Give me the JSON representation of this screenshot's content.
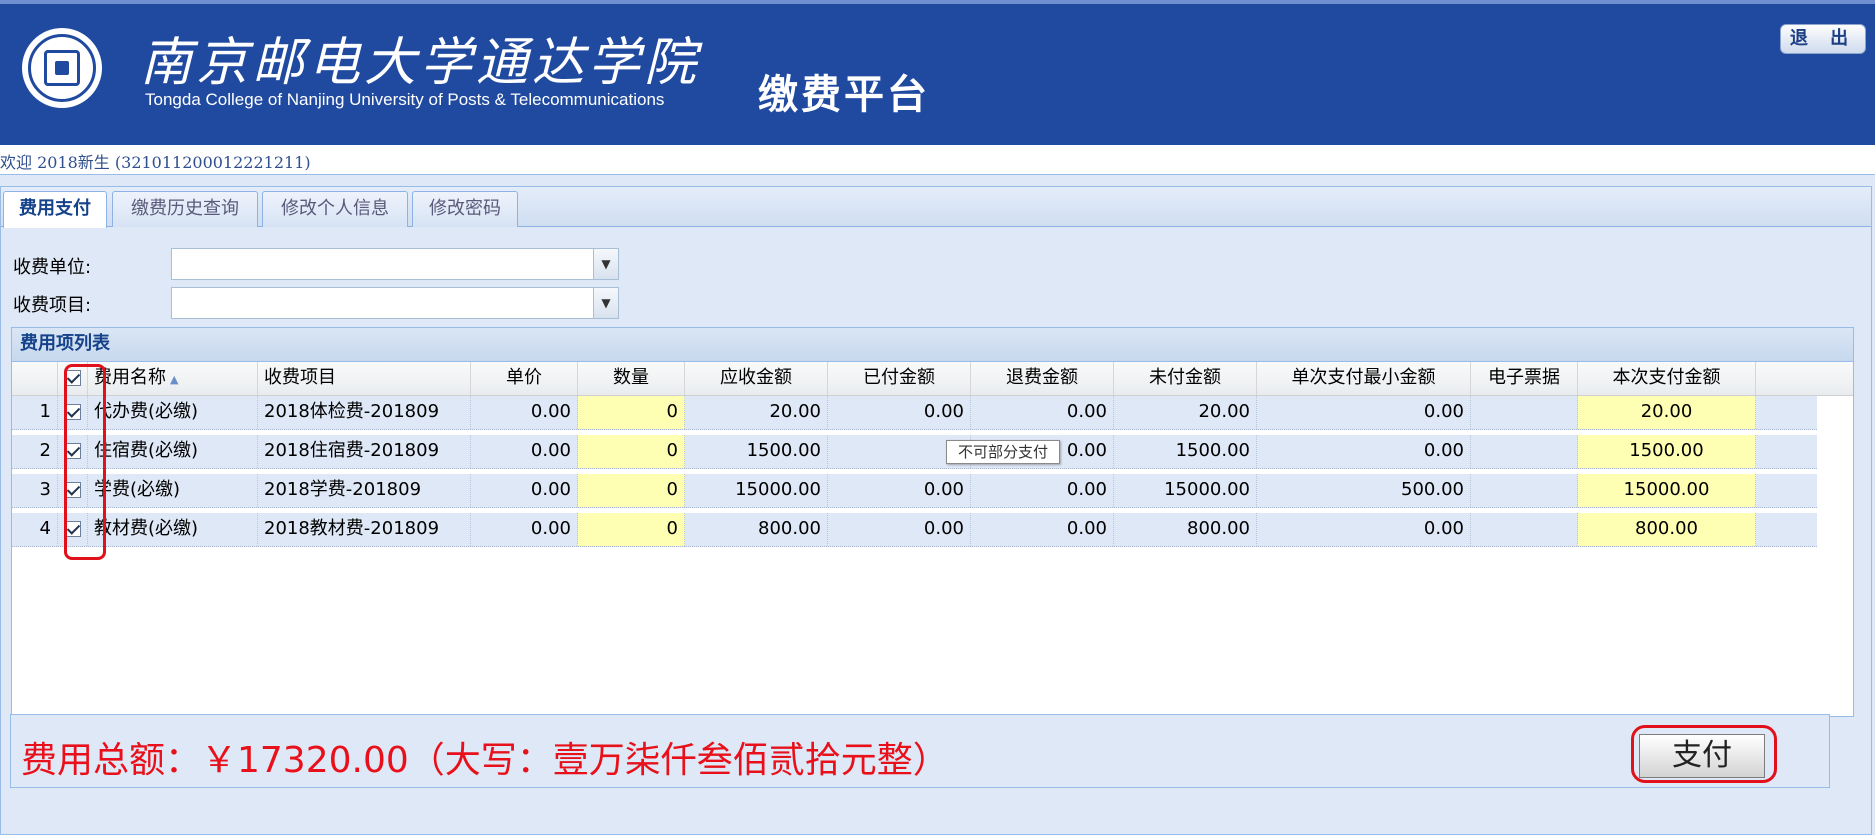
{
  "header": {
    "college_name_cn": "南京邮电大学通达学院",
    "college_name_en": "Tongda College of Nanjing University of Posts & Telecommunications",
    "platform_title": "缴费平台",
    "logout_label": "退 出"
  },
  "welcome": {
    "text": "欢迎 2018新生 (321011200012221211)"
  },
  "tabs": [
    {
      "label": "费用支付",
      "active": true
    },
    {
      "label": "缴费历史查询",
      "active": false
    },
    {
      "label": "修改个人信息",
      "active": false
    },
    {
      "label": "修改密码",
      "active": false
    }
  ],
  "form": {
    "unit_label": "收费单位:",
    "unit_value": "",
    "item_label": "收费项目:",
    "item_value": ""
  },
  "grid": {
    "title": "费用项列表",
    "columns": [
      "费用名称",
      "收费项目",
      "单价",
      "数量",
      "应收金额",
      "已付金额",
      "退费金额",
      "未付金额",
      "单次支付最小金额",
      "电子票据",
      "本次支付金额"
    ],
    "rows": [
      {
        "no": "1",
        "checked": true,
        "name": "代办费(必缴)",
        "item": "2018体检费-201809",
        "unit_price": "0.00",
        "qty": "0",
        "due": "20.00",
        "paid": "0.00",
        "refund": "0.00",
        "unpaid": "20.00",
        "min_pay": "0.00",
        "receipt": "",
        "pay_now": "20.00"
      },
      {
        "no": "2",
        "checked": true,
        "name": "住宿费(必缴)",
        "item": "2018住宿费-201809",
        "unit_price": "0.00",
        "qty": "0",
        "due": "1500.00",
        "paid": "",
        "refund": "0.00",
        "unpaid": "1500.00",
        "min_pay": "0.00",
        "receipt": "",
        "pay_now": "1500.00"
      },
      {
        "no": "3",
        "checked": true,
        "name": "学费(必缴)",
        "item": "2018学费-201809",
        "unit_price": "0.00",
        "qty": "0",
        "due": "15000.00",
        "paid": "0.00",
        "refund": "0.00",
        "unpaid": "15000.00",
        "min_pay": "500.00",
        "receipt": "",
        "pay_now": "15000.00"
      },
      {
        "no": "4",
        "checked": true,
        "name": "教材费(必缴)",
        "item": "2018教材费-201809",
        "unit_price": "0.00",
        "qty": "0",
        "due": "800.00",
        "paid": "0.00",
        "refund": "0.00",
        "unpaid": "800.00",
        "min_pay": "0.00",
        "receipt": "",
        "pay_now": "800.00"
      }
    ],
    "tooltip": "不可部分支付"
  },
  "footer": {
    "total_text": "费用总额：￥17320.00（大写：壹万柒仟叁佰贰拾元整）",
    "pay_label": "支付"
  },
  "colors": {
    "header_bg": "#1f4aa0",
    "panel_bg": "#dfe8f6",
    "highlight_red": "#e0111a",
    "editable_cell": "#ffffb3"
  }
}
